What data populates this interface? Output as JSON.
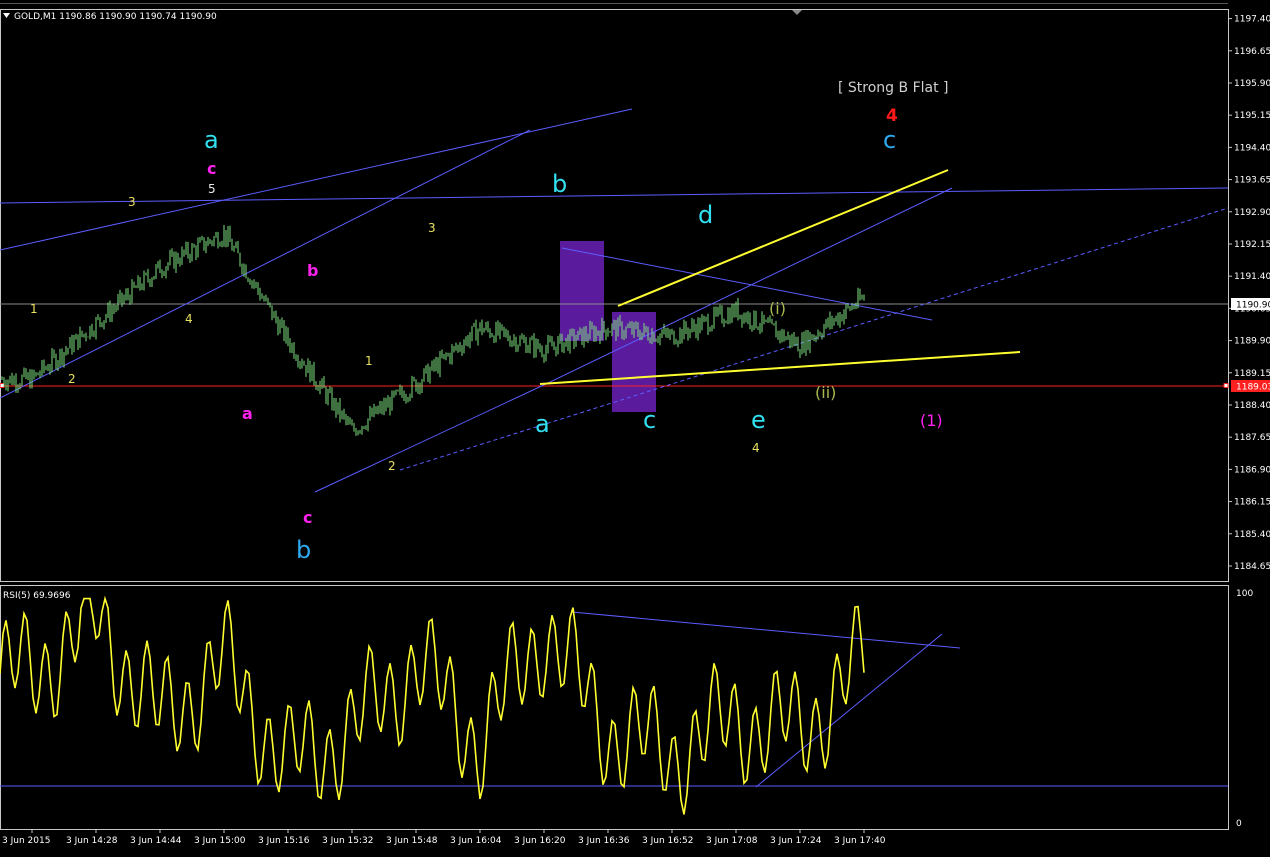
{
  "colors": {
    "background": "#000000",
    "axis": "#c8c8c8",
    "price_candles": "#7ee07e",
    "wave_cyan": "#33e0f0",
    "wave_blue": "#2ea8f0",
    "wave_magenta": "#ff22ee",
    "wave_minor": "#e8e060",
    "wave_olive": "#a8b850",
    "wave_red": "#ff1a1a",
    "trendline": "#5c5cff",
    "yellow_line": "#ffff30",
    "current_price_line": "#8a8a8a",
    "support_line": "#ff2020",
    "highlight_box": "#5a1c9c",
    "rsi_line": "#ffff30"
  },
  "header": {
    "label": "GOLD,M1  1190.86 1190.90 1190.74 1190.90",
    "dropdown_icon": "triangle-down-icon"
  },
  "price_axis": {
    "ticks": [
      "1197.40",
      "1196.65",
      "1195.90",
      "1195.15",
      "1194.40",
      "1193.65",
      "1192.90",
      "1192.15",
      "1191.40",
      "1190.65",
      "1189.90",
      "1189.15",
      "1188.40",
      "1187.65",
      "1186.90",
      "1186.15",
      "1185.40",
      "1184.65"
    ],
    "current_price": "1190.90",
    "marked_level": "1189.03"
  },
  "time_axis": {
    "labels": [
      "3 Jun 2015",
      "3 Jun 14:28",
      "3 Jun 14:44",
      "3 Jun 15:00",
      "3 Jun 15:16",
      "3 Jun 15:32",
      "3 Jun 15:48",
      "3 Jun 16:04",
      "3 Jun 16:20",
      "3 Jun 16:36",
      "3 Jun 16:52",
      "3 Jun 17:08",
      "3 Jun 17:24",
      "3 Jun 17:40"
    ]
  },
  "annotations": {
    "strong_b_flat": "[ Strong B Flat ]",
    "four_red": "4",
    "c_top_right": "c",
    "a_top_left": "a",
    "c_top_left": "c",
    "five_top": "5",
    "three_left": "3",
    "one_left": "1",
    "two_left": "2",
    "four_left": "4",
    "b_magenta": "b",
    "a_magenta": "a",
    "c_magenta_low": "c",
    "b_blue_low": "b",
    "one_mid": "1",
    "two_mid": "2",
    "three_mid": "3",
    "b_cyan": "b",
    "a_cyan": "a",
    "c_cyan": "c",
    "d_cyan": "d",
    "e_cyan": "e",
    "four_low": "4",
    "i_olive": "(i)",
    "ii_olive": "(ii)",
    "one_magenta": "(1)"
  },
  "rsi": {
    "label": "RSI(5) 69.9696",
    "axis_max": "100",
    "axis_min": "0"
  },
  "chart_data": [
    {
      "type": "candlestick",
      "symbol": "GOLD",
      "timeframe": "M1",
      "ylim": [
        1184.3,
        1197.6
      ],
      "x": [
        "3 Jun 2015",
        "3 Jun 14:28",
        "3 Jun 14:44",
        "3 Jun 15:00",
        "3 Jun 15:16",
        "3 Jun 15:32",
        "3 Jun 15:48",
        "3 Jun 16:04",
        "3 Jun 16:20",
        "3 Jun 16:36",
        "3 Jun 16:52",
        "3 Jun 17:08",
        "3 Jun 17:24",
        "3 Jun 17:40"
      ],
      "series": [
        {
          "name": "close",
          "values": [
            1189.0,
            1190.3,
            1191.6,
            1192.4,
            1189.9,
            1187.8,
            1188.9,
            1190.2,
            1189.7,
            1190.2,
            1190.0,
            1190.6,
            1189.8,
            1190.9
          ]
        }
      ]
    },
    {
      "type": "line",
      "ylim": [
        0,
        100
      ],
      "x": [
        "3 Jun 2015",
        "3 Jun 14:28",
        "3 Jun 14:44",
        "3 Jun 15:00",
        "3 Jun 15:16",
        "3 Jun 15:32",
        "3 Jun 15:48",
        "3 Jun 16:04",
        "3 Jun 16:20",
        "3 Jun 16:36",
        "3 Jun 16:52",
        "3 Jun 17:08",
        "3 Jun 17:24",
        "3 Jun 17:40"
      ],
      "series": [
        {
          "name": "RSI(5)",
          "values": [
            65,
            90,
            45,
            70,
            25,
            40,
            70,
            35,
            85,
            40,
            30,
            45,
            40,
            70
          ]
        }
      ]
    }
  ]
}
